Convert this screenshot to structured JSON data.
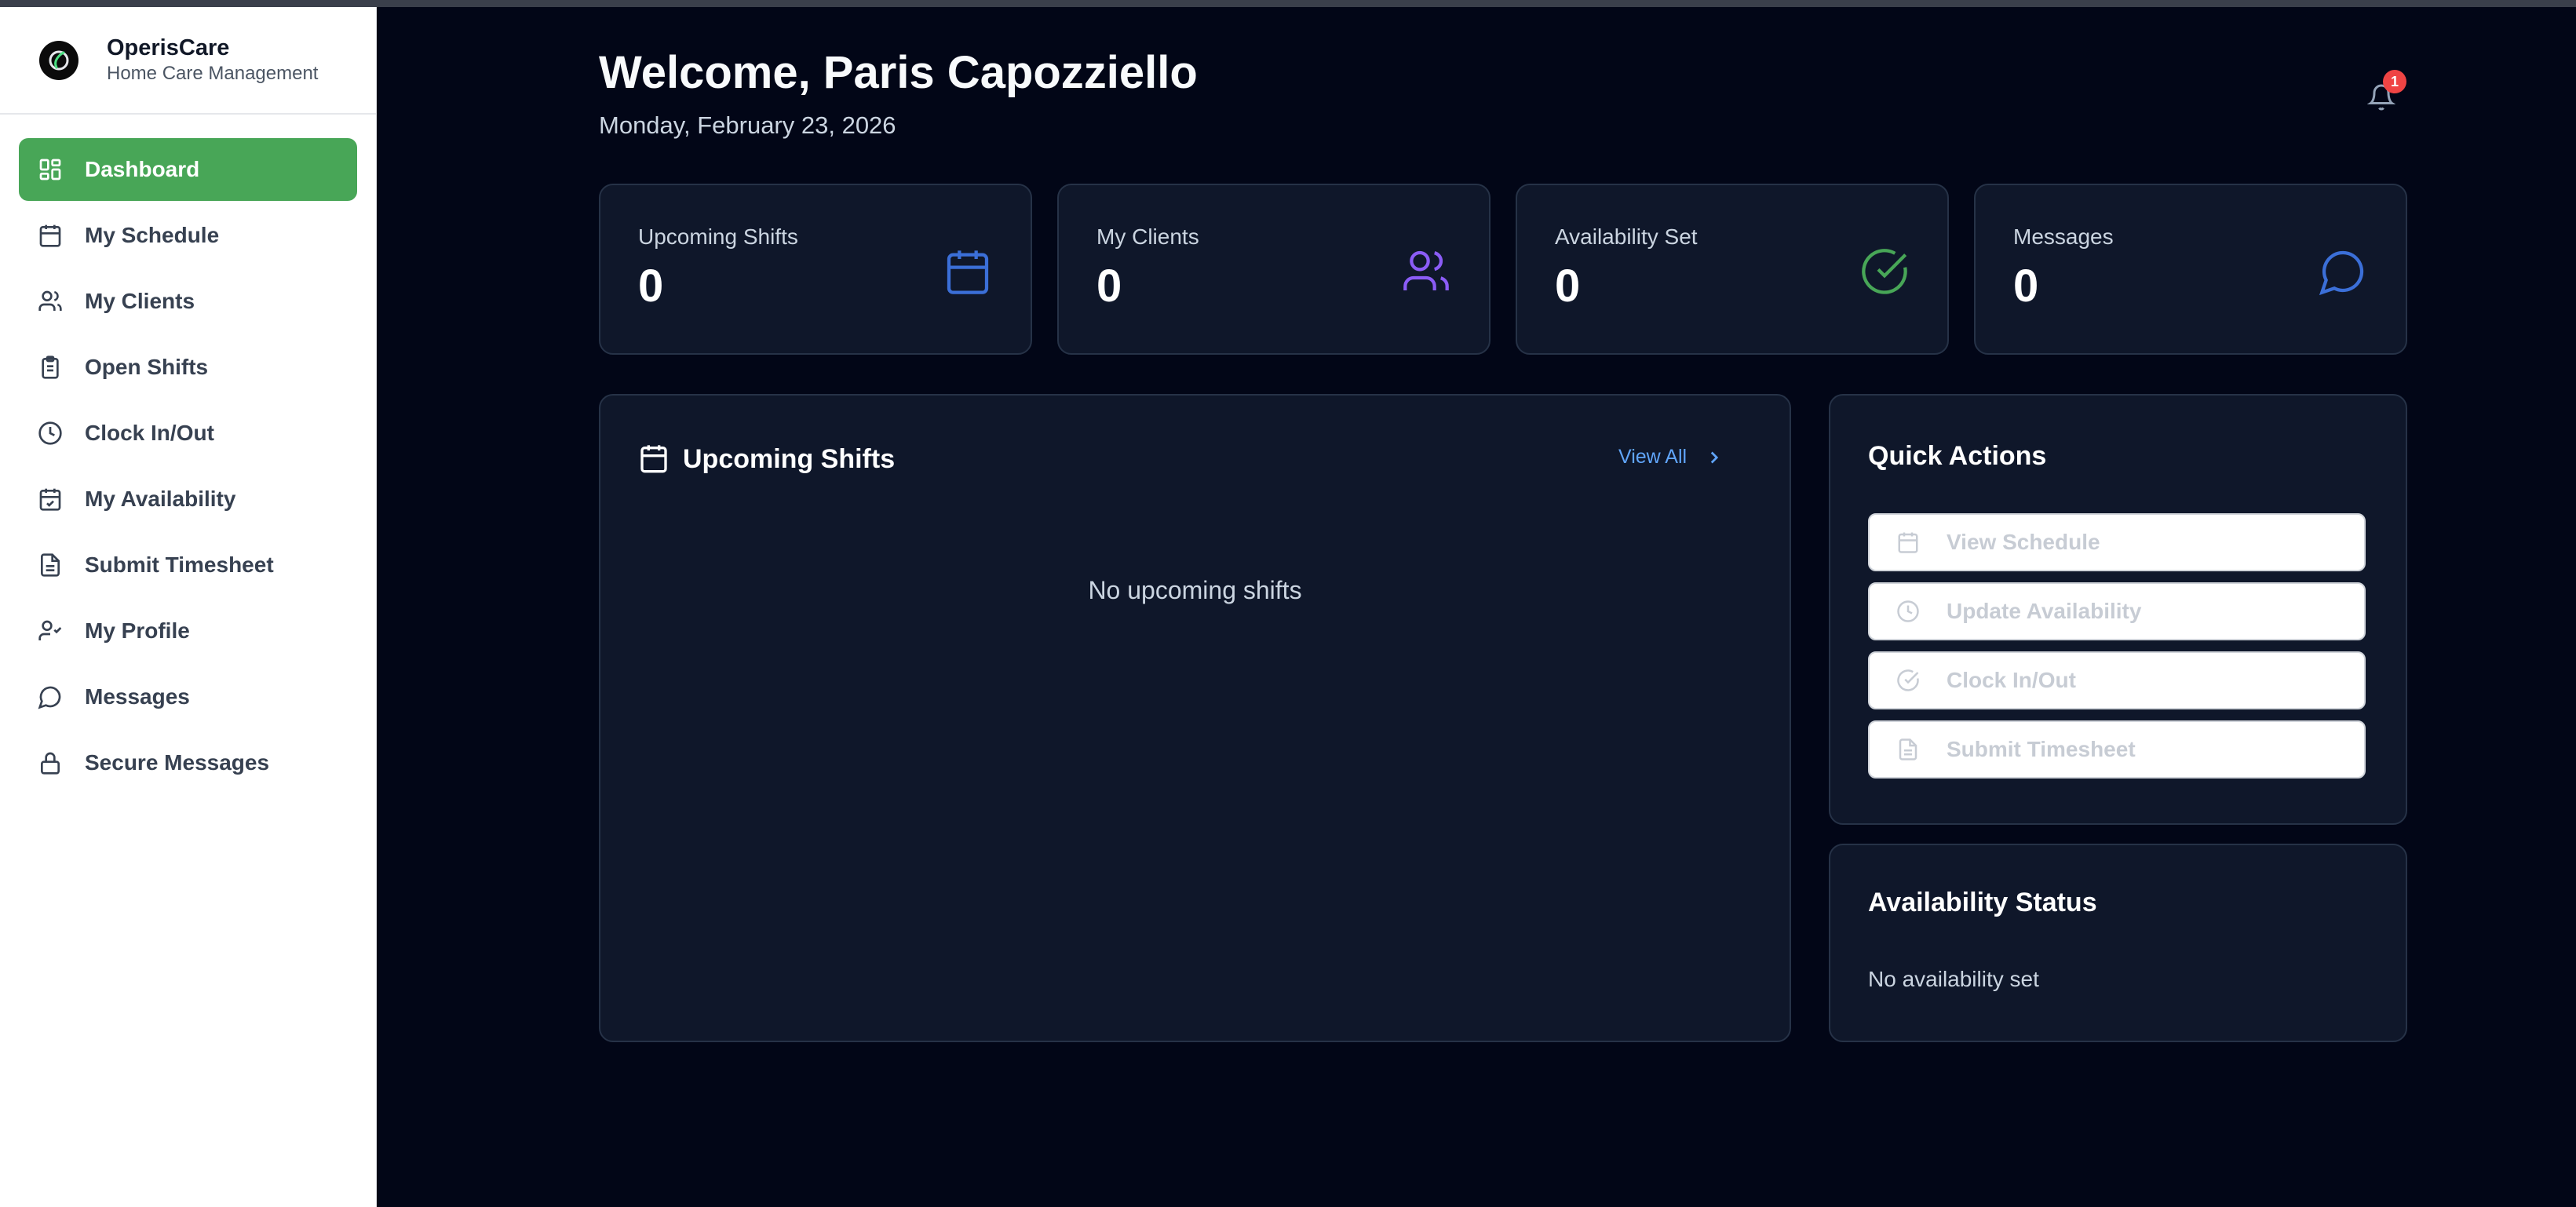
{
  "brand": {
    "name": "OperisCare",
    "subtitle": "Home Care Management"
  },
  "sidebar": {
    "items": [
      {
        "label": "Dashboard",
        "icon": "dashboard-icon",
        "active": true
      },
      {
        "label": "My Schedule",
        "icon": "calendar-icon"
      },
      {
        "label": "My Clients",
        "icon": "users-icon"
      },
      {
        "label": "Open Shifts",
        "icon": "clipboard-icon"
      },
      {
        "label": "Clock In/Out",
        "icon": "clock-icon"
      },
      {
        "label": "My Availability",
        "icon": "calendar-check-icon"
      },
      {
        "label": "Submit Timesheet",
        "icon": "document-icon"
      },
      {
        "label": "My Profile",
        "icon": "user-check-icon"
      },
      {
        "label": "Messages",
        "icon": "message-icon"
      },
      {
        "label": "Secure Messages",
        "icon": "lock-icon"
      }
    ]
  },
  "header": {
    "welcome": "Welcome, Paris Capozziello",
    "date": "Monday, February 23, 2026",
    "notification_count": "1"
  },
  "stats": [
    {
      "label": "Upcoming Shifts",
      "value": "0",
      "icon": "calendar-icon",
      "color": "#3b6fd8"
    },
    {
      "label": "My Clients",
      "value": "0",
      "icon": "users-icon",
      "color": "#8b5cf6"
    },
    {
      "label": "Availability Set",
      "value": "0",
      "icon": "check-circle-icon",
      "color": "#48a657"
    },
    {
      "label": "Messages",
      "value": "0",
      "icon": "message-icon",
      "color": "#3b6fd8"
    }
  ],
  "upcoming": {
    "title": "Upcoming Shifts",
    "view_all": "View All",
    "empty": "No upcoming shifts"
  },
  "quick_actions": {
    "title": "Quick Actions",
    "buttons": [
      {
        "label": "View Schedule",
        "icon": "calendar-icon"
      },
      {
        "label": "Update Availability",
        "icon": "clock-icon"
      },
      {
        "label": "Clock In/Out",
        "icon": "check-circle-icon"
      },
      {
        "label": "Submit Timesheet",
        "icon": "document-icon"
      }
    ]
  },
  "availability": {
    "title": "Availability Status",
    "text": "No availability set"
  },
  "colors": {
    "accent": "#48a657",
    "background": "#020617",
    "card": "#0f172a"
  }
}
